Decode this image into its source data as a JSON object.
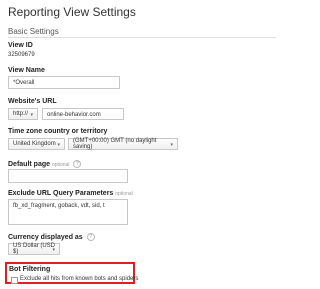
{
  "page": {
    "title": "Reporting View Settings"
  },
  "section": {
    "title": "Basic Settings"
  },
  "view_id": {
    "label": "View ID",
    "value": "32509679"
  },
  "view_name": {
    "label": "View Name",
    "value": "*Overall"
  },
  "website_url": {
    "label": "Website's URL",
    "protocol": "http://",
    "value": "online-behavior.com"
  },
  "time_zone": {
    "label": "Time zone country or territory",
    "country": "United Kingdom",
    "zone": "(GMT+00:00) GMT (no daylight saving)"
  },
  "default_page": {
    "label": "Default page",
    "optional": "optional",
    "value": ""
  },
  "exclude_params": {
    "label": "Exclude URL Query Parameters",
    "optional": "optional",
    "value": "fb_xd_fragment, goback, vdt, sid, t"
  },
  "currency": {
    "label": "Currency displayed as",
    "value": "US Dollar (USD $)"
  },
  "bot_filtering": {
    "label": "Bot Filtering",
    "checkbox_label": "Exclude all hits from known bots and spiders",
    "checked": false
  },
  "colors": {
    "highlight": "#e02020",
    "border": "#c8c8c8"
  },
  "icons": {
    "help": "?",
    "chevron": "▾"
  }
}
